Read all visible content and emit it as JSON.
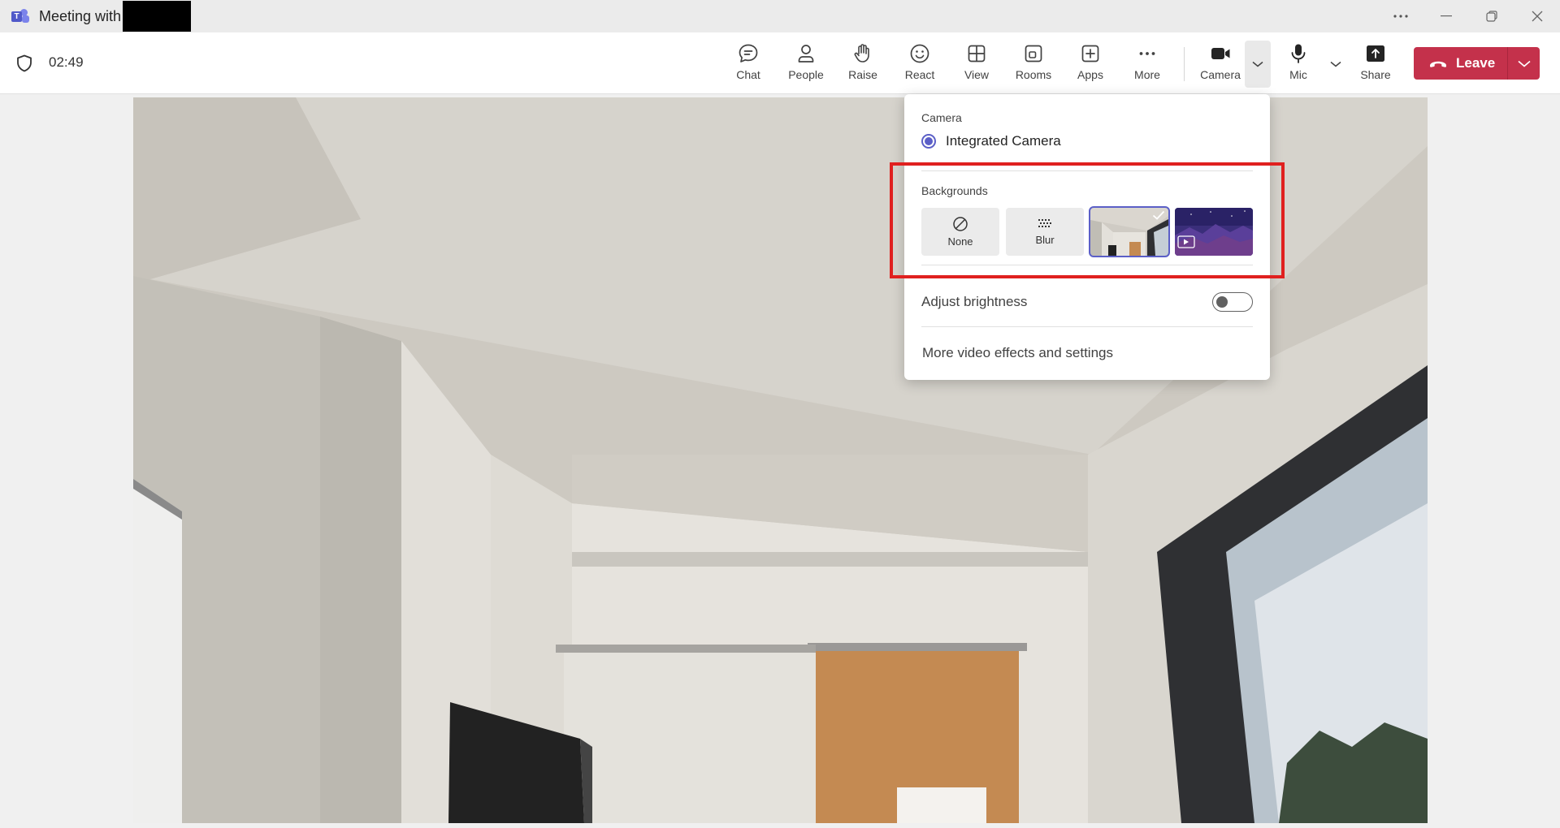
{
  "window": {
    "title": "Meeting with",
    "controls": [
      "more-options-icon",
      "minimize-icon",
      "restore-icon",
      "close-icon"
    ]
  },
  "meeting": {
    "timer": "02:49"
  },
  "toolbar": {
    "items": [
      {
        "label": "Chat",
        "icon": "chat-icon"
      },
      {
        "label": "People",
        "icon": "people-icon"
      },
      {
        "label": "Raise",
        "icon": "raise-hand-icon"
      },
      {
        "label": "React",
        "icon": "react-icon"
      },
      {
        "label": "View",
        "icon": "view-icon"
      },
      {
        "label": "Rooms",
        "icon": "rooms-icon"
      },
      {
        "label": "Apps",
        "icon": "apps-icon"
      },
      {
        "label": "More",
        "icon": "more-icon"
      }
    ],
    "camera_label": "Camera",
    "mic_label": "Mic",
    "share_label": "Share",
    "leave_label": "Leave"
  },
  "camera_menu": {
    "camera_heading": "Camera",
    "selected_camera": "Integrated Camera",
    "backgrounds_heading": "Backgrounds",
    "backgrounds": [
      {
        "label": "None",
        "selected": false
      },
      {
        "label": "Blur",
        "selected": false
      },
      {
        "label": "",
        "selected": true
      },
      {
        "label": "",
        "selected": false
      }
    ],
    "adjust_brightness_label": "Adjust brightness",
    "adjust_brightness_on": false,
    "more_settings_label": "More video effects and settings"
  },
  "colors": {
    "accent": "#5b5fc7",
    "leave": "#c4314b",
    "highlight": "#e0201f"
  }
}
